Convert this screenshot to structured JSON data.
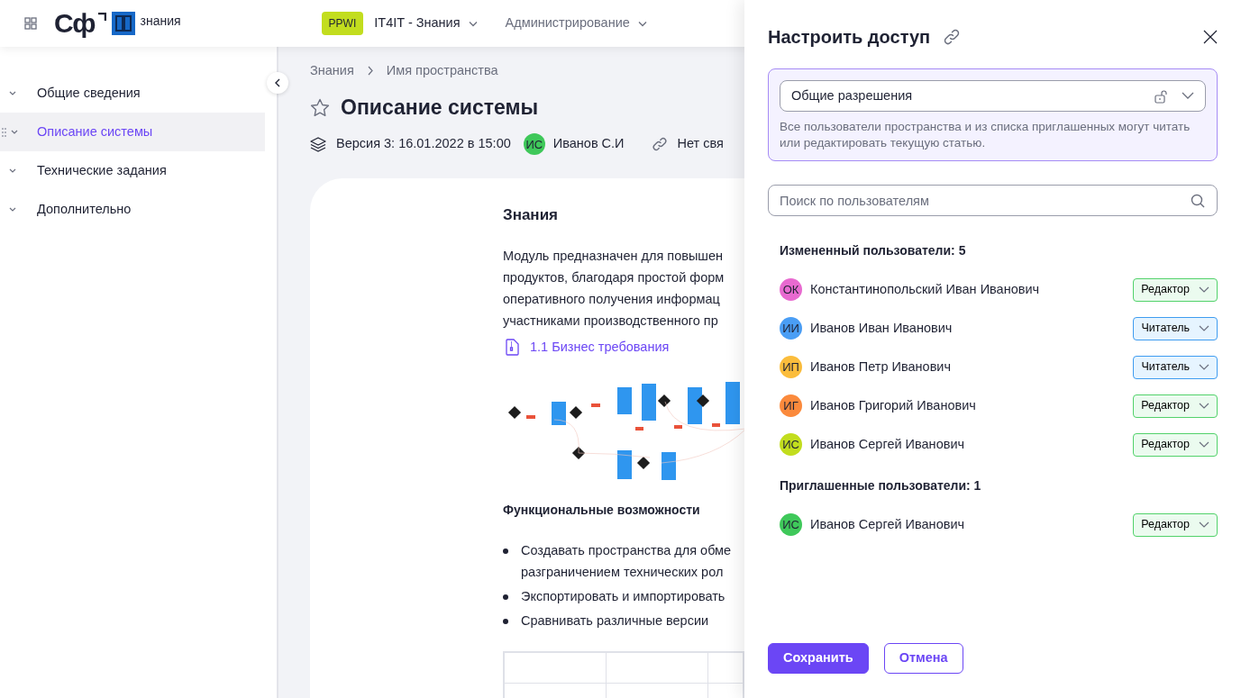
{
  "header": {
    "logo_text": "Сф",
    "logo_caption": "знания",
    "space_badge": "PPWI",
    "menus": [
      {
        "label": "IT4IT - Знания"
      },
      {
        "label": "Администрирование"
      }
    ]
  },
  "sidebar": {
    "items": [
      {
        "label": "Общие сведения",
        "selected": false
      },
      {
        "label": "Описание системы",
        "selected": true
      },
      {
        "label": "Технические задания",
        "selected": false
      },
      {
        "label": "Дополнительно",
        "selected": false
      }
    ]
  },
  "breadcrumbs": [
    "Знания",
    "Имя пространства"
  ],
  "page": {
    "title": "Описание системы",
    "version": "Версия 3: 16.01.2022 в 15:00",
    "author_initials": "ИС",
    "author": "Иванов С.И",
    "links": "Нет свя"
  },
  "article": {
    "heading": "Знания",
    "paragraph_lines": [
      "Модуль предназначен для повышен",
      "продуктов, благодаря простой форм",
      "оперативного получения информац",
      "участниками производственного пр"
    ],
    "attachment": "1.1 Бизнес требования",
    "features_heading": "Функциональные возможности",
    "bullets": [
      {
        "lines": [
          "Создавать пространства для обме",
          "разграничением технических рол"
        ]
      },
      {
        "lines": [
          "Экспортировать и импортировать"
        ]
      },
      {
        "lines": [
          "Сравнивать различные версии"
        ]
      }
    ]
  },
  "drawer": {
    "title": "Настроить доступ",
    "permission": {
      "value": "Общие разрешения",
      "hint": "Все пользователи пространства и из списка приглашенных могут читать или редактировать текущую статью."
    },
    "search": {
      "placeholder": "Поиск по пользователям"
    },
    "groups": [
      {
        "heading": "Измененный пользователи: 5",
        "users": [
          {
            "initials": "ОК",
            "name": "Константинопольский Иван Иванович",
            "color": "#e86ad0",
            "role": "Редактор",
            "kind": "editor"
          },
          {
            "initials": "ИИ",
            "name": "Иванов Иван Иванович",
            "color": "#4a9ef5",
            "role": "Читатель",
            "kind": "reader"
          },
          {
            "initials": "ИП",
            "name": "Иванов Петр Иванович",
            "color": "#fbbd3c",
            "role": "Читатель",
            "kind": "reader"
          },
          {
            "initials": "ИГ",
            "name": "Иванов Григорий Иванович",
            "color": "#fb8a3c",
            "role": "Редактор",
            "kind": "editor"
          },
          {
            "initials": "ИС",
            "name": "Иванов Сергей Иванович",
            "color": "#c2dd1e",
            "role": "Редактор",
            "kind": "editor"
          }
        ]
      },
      {
        "heading": "Приглашенные пользователи: 1",
        "users": [
          {
            "initials": "ИС",
            "name": "Иванов Сергей Иванович",
            "color": "#3fc85a",
            "role": "Редактор",
            "kind": "editor"
          }
        ]
      }
    ],
    "buttons": [
      {
        "label": "Сохранить",
        "kind": "primary"
      },
      {
        "label": "Отмена",
        "kind": "secondary"
      }
    ]
  }
}
